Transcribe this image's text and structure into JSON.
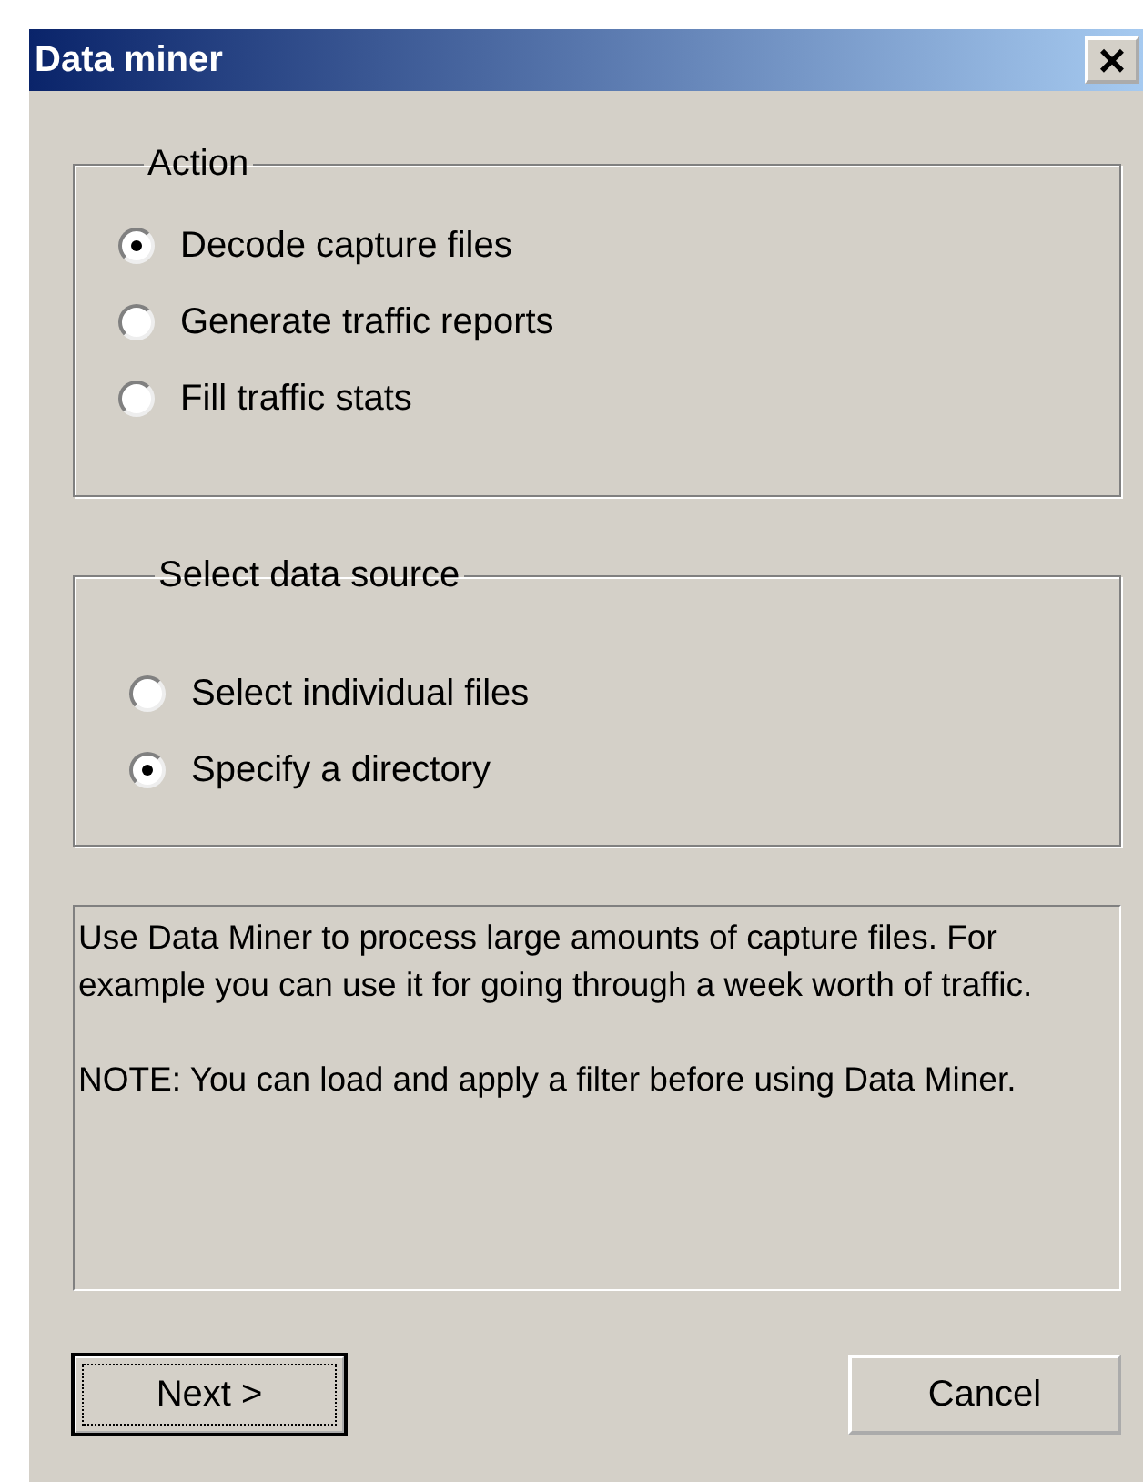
{
  "window": {
    "title": "Data miner",
    "close": "×"
  },
  "groups": [
    {
      "legend": "Action",
      "options": [
        {
          "label": "Decode capture files",
          "selected": true
        },
        {
          "label": "Generate traffic reports",
          "selected": false
        },
        {
          "label": "Fill traffic stats",
          "selected": false
        }
      ]
    },
    {
      "legend": "Select data source",
      "options": [
        {
          "label": "Select individual files",
          "selected": false
        },
        {
          "label": "Specify a directory",
          "selected": true
        }
      ]
    }
  ],
  "description": [
    "Use Data Miner to process large amounts of capture files. For example you can use it for going through a week worth of traffic.",
    "NOTE: You can load and apply a filter before using Data Miner."
  ],
  "buttons": [
    {
      "label": "Next >",
      "focused": true
    },
    {
      "label": "Cancel",
      "focused": false
    }
  ]
}
